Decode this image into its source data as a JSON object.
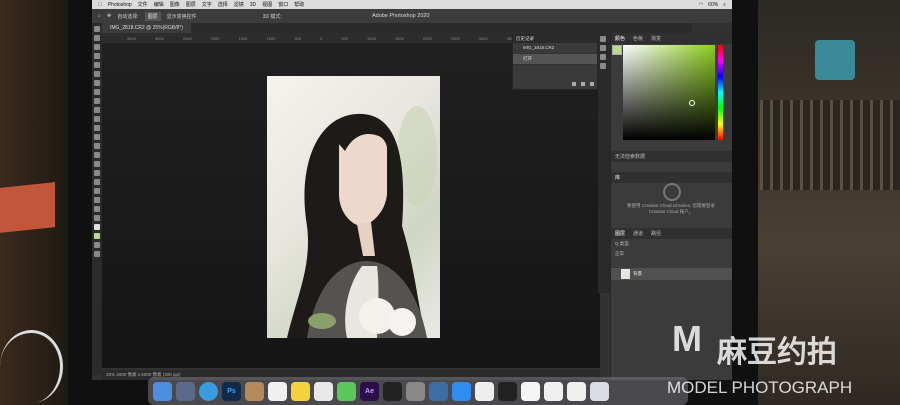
{
  "menubar": {
    "app_name": "Photoshop",
    "items": [
      "文件",
      "编辑",
      "图像",
      "图层",
      "文字",
      "选择",
      "滤镜",
      "3D",
      "视图",
      "窗口",
      "帮助"
    ],
    "battery": "60%"
  },
  "options_bar": {
    "auto_select_label": "自动选择:",
    "auto_select_value": "图层",
    "show_transform_label": "显示变换控件",
    "mode_3d": "3D 模式:"
  },
  "window_title": "Adobe Photoshop 2020",
  "document_tab": "IMG_2818.CR2 @ 25%(RGB/8*)",
  "ruler_ticks": [
    "3500",
    "3000",
    "2500",
    "2000",
    "1500",
    "1000",
    "500",
    "0",
    "500",
    "1000",
    "1500",
    "2000",
    "2500",
    "3000",
    "3500",
    "4000",
    "4500",
    "5000",
    "5500"
  ],
  "status": "25%    4000 像素 x 6000 像素 (300 ppi)",
  "history_panel": {
    "title": "历史记录",
    "file": "IMG_2818.CR2",
    "state": "打开"
  },
  "color_panel": {
    "tabs": [
      "颜色",
      "色板",
      "渐变"
    ]
  },
  "libraries_panel": {
    "title": "库",
    "message": "要使用 Creative Cloud Libraries, 您需要登录 Creative Cloud 账户。"
  },
  "adjustments_title": "无法检索数据",
  "layers_panel": {
    "tabs": [
      "图层",
      "通道",
      "路径"
    ],
    "kind_label": "Q 类型",
    "blend": "正常",
    "layer_name": "背景"
  },
  "dock": {
    "icons": [
      "finder-icon",
      "launchpad-icon",
      "safari-icon",
      "photoshop-icon",
      "contacts-icon",
      "calendar-icon",
      "notes-icon",
      "music-icon",
      "messages-icon",
      "after-effects-icon",
      "final-cut-icon",
      "system-preferences-icon",
      "quicktime-icon",
      "appstore-icon",
      "finder2-icon",
      "qq-icon",
      "photos-icon",
      "document-icon",
      "document2-icon",
      "trash-icon"
    ],
    "ps_label": "Ps",
    "ae_label": "Ae"
  },
  "watermark": {
    "brand": "M",
    "brand_cn": "麻豆约拍",
    "sub": "MODEL PHOTOGRAPH"
  }
}
